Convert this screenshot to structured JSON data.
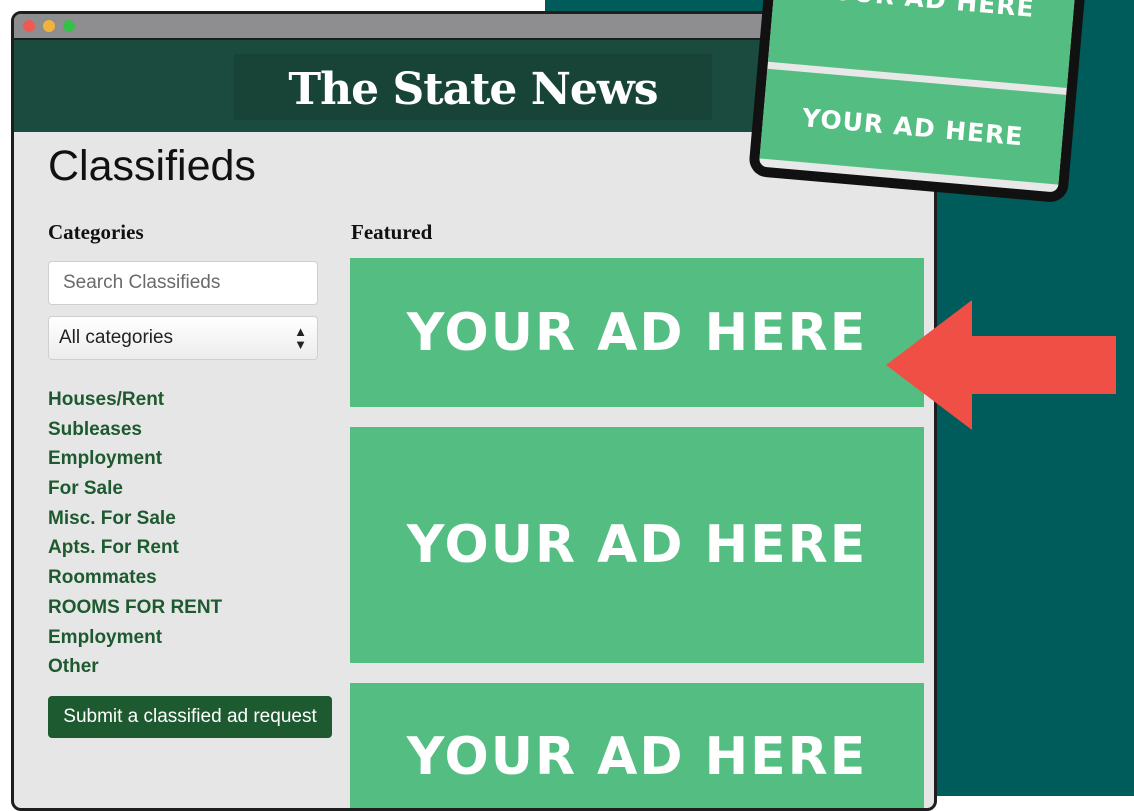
{
  "brand": {
    "masthead_title": "The State News",
    "colors": {
      "masthead": "#1b4b3e",
      "link_green": "#1e5a30",
      "ad_green": "#54bd82",
      "teal_bg": "#005c5a",
      "arrow_red": "#ef4f45"
    }
  },
  "page": {
    "title": "Classifieds"
  },
  "sidebar": {
    "heading": "Categories",
    "search_placeholder": "Search Classifieds",
    "category_select": {
      "selected": "All categories"
    },
    "categories": [
      "Houses/Rent",
      "Subleases",
      "Employment",
      "For Sale",
      "Misc. For Sale",
      "Apts. For Rent",
      "Roommates",
      "ROOMS FOR RENT",
      "Employment",
      "Other"
    ],
    "submit_label": "Submit a classified ad request"
  },
  "featured": {
    "heading": "Featured",
    "ads": [
      "YOUR AD HERE",
      "YOUR AD HERE",
      "YOUR AD HERE"
    ]
  },
  "tablet": {
    "ads": [
      "YOUR AD HERE",
      "YOUR AD HERE"
    ]
  },
  "icons": {
    "window_controls": [
      "close-dot",
      "minimize-dot",
      "maximize-dot"
    ],
    "select_arrow": "up-down-chevron-icon",
    "pointer": "left-arrow-icon"
  }
}
